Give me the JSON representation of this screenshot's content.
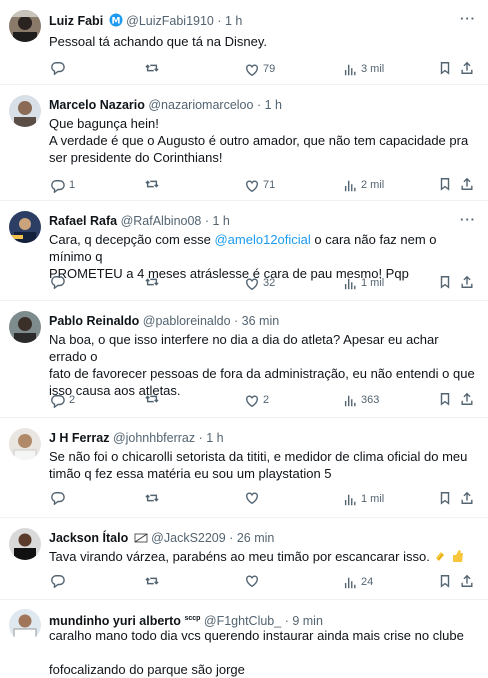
{
  "tweets": [
    {
      "name": "Luiz Fabi",
      "handle": "@LuizFabi1910",
      "time": "· 1 h",
      "lines": [
        "Pessoal tá achando que tá na Disney."
      ],
      "reply": "",
      "repost": "",
      "like": "79",
      "views": "3 mil"
    },
    {
      "name": "Marcelo Nazario",
      "handle": "@nazariomarceloo",
      "time": "· 1 h",
      "lines": [
        "Que bagunça hein!",
        "A verdade é que o Augusto é outro amador, que não tem capacidade pra",
        "ser presidente do Corinthians!"
      ],
      "reply": "1",
      "repost": "",
      "like": "71",
      "views": "2 mil"
    },
    {
      "name": "Rafael Rafa",
      "handle": "@RafAlbino08",
      "time": "· 1 h",
      "line1_pre": "Cara, q decepção com esse ",
      "mention": "@amelo12oficial",
      "line1_post": " o cara não faz nem o mínimo q",
      "line2": "PROMETEU a 4 meses atráslesse é cara de pau mesmo! Pqp",
      "reply": "",
      "repost": "",
      "like": "32",
      "views": "1 mil"
    },
    {
      "name": "Pablo Reinaldo",
      "handle": "@pabloreinaldo",
      "time": "· 36 min",
      "lines": [
        "Na boa, o que isso interfere no dia a dia do atleta? Apesar eu achar errado o",
        "fato de favorecer pessoas de fora da administração, eu não entendi o que",
        "isso causa aos atletas."
      ],
      "reply": "2",
      "repost": "",
      "like": "2",
      "views": "363"
    },
    {
      "name": "J H Ferraz",
      "handle": "@johnhbferraz",
      "time": "· 1 h",
      "lines": [
        "Se não foi o chicarolli setorista da tititi, e medidor de clima oficial do meu",
        "timão q fez essa matéria eu sou um playstation 5"
      ],
      "reply": "",
      "repost": "",
      "like": "",
      "views": "1 mil"
    },
    {
      "name": "Jackson Ítalo",
      "handle": "@JackS2209",
      "time": "· 26 min",
      "lines": [
        "Tava virando várzea, parabéns ao meu timão por escancarar isso."
      ],
      "reply": "",
      "repost": "",
      "like": "",
      "views": "24"
    },
    {
      "name": "mundinho yuri alberto",
      "name_suffix": "sccp",
      "handle": "@F1ghtClub_",
      "time": "· 9 min",
      "lines": [
        "caralho mano todo dia vcs querendo instaurar ainda mais crise no clube",
        "",
        "fofocalizando do parque são jorge"
      ],
      "reply": "",
      "repost": "",
      "like": "",
      "views": ""
    }
  ],
  "icons": {
    "reply": "reply-icon",
    "repost": "repost-icon",
    "like": "like-icon",
    "views": "views-icon",
    "bookmark": "bookmark-icon",
    "share": "share-icon",
    "more": "more-icon"
  },
  "colors": {
    "link": "#1d9bf0",
    "secondary": "#536471",
    "verified": "#1d9bf0"
  }
}
